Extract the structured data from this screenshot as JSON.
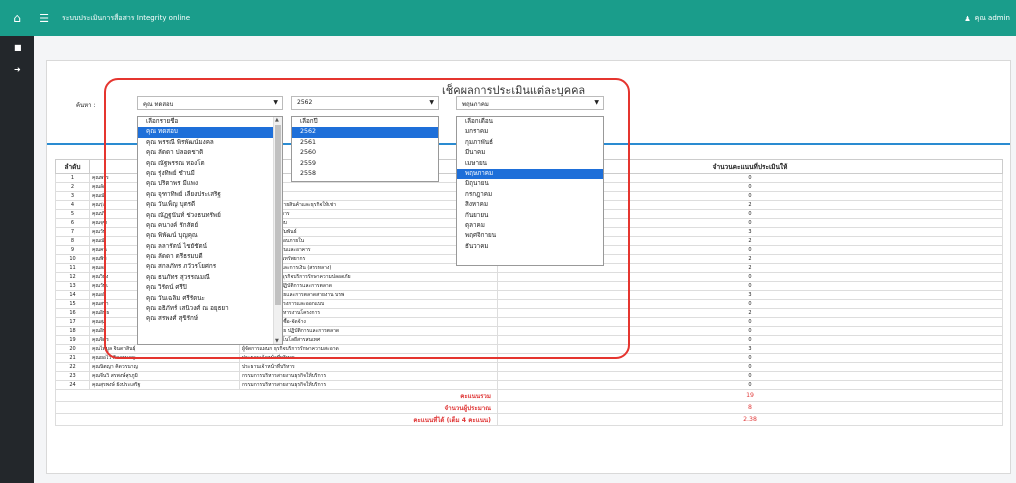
{
  "header": {
    "app_title": "ระบบประเมินการสื่อสาร Integrity online",
    "user": "คุณ admin"
  },
  "page": {
    "title": "เช็คผลการประเมินแต่ละบุคคล",
    "name_label": "ค้นหา :"
  },
  "filters": {
    "person": {
      "value": "คุณ ทดสอบ",
      "options": [
        "เลือกรายชื่อ",
        "คุณ ทดสอบ",
        "คุณ พรรณี พิรพัฒน์มงคล",
        "คุณ ลัดดา ปลอดชาติ",
        "คุณ ณัฐพรรณ ทองโต",
        "คุณ รุ่งทิพย์ ชำนมี",
        "คุณ ปริตาพร มีแพง",
        "คุณ จุฑาทิพย์ เลี่ยงประเสริฐ",
        "คุณ วันเพ็ญ บุตรดี",
        "คุณ ณัฏฐนันท์ ช่วงธนทรัพย์",
        "คุณ คนางค์ รักสัตย์",
        "คุณ พิพัฒน์ บุญคุณ",
        "คุณ ลลารัตน์ ไชยัชัตน์",
        "คุณ ลัดดา ตรีธรมบดี",
        "คุณ สกลภัทร ภวัวรโยศกร",
        "คุณ ธนภัทร สุวรรณมณี",
        "คุณ วิรัตน์ ศรีปิ",
        "คุณ วันเฉลิม ศรีรัตนะ",
        "คุณ อธิภัทร์ เสนิวงศ์ ณ อยุธยา",
        "คุณ สรพงศ์ สุขิรักษ์"
      ],
      "selected_index": 1
    },
    "year": {
      "value": "2562",
      "options": [
        "เลือกปี",
        "2562",
        "2561",
        "2560",
        "2559",
        "2558"
      ],
      "selected_index": 1
    },
    "month": {
      "value": "พฤษภาคม",
      "options": [
        "เลือกเดือน",
        "มกราคม",
        "กุมภาพันธ์",
        "มีนาคม",
        "เมษายน",
        "พฤษภาคม",
        "มิถุนายน",
        "กรกฎาคม",
        "สิงหาคม",
        "กันยายน",
        "ตุลาคม",
        "พฤศจิกายน",
        "ธันวาคม"
      ],
      "selected_index": 5
    }
  },
  "table": {
    "headers": {
      "order": "ลำดับ",
      "score": "จำนวนคะแนนที่ประเมินให้"
    },
    "rows": [
      {
        "no": "1",
        "name": "คุณพรร",
        "pos": "",
        "score": "0"
      },
      {
        "no": "2",
        "name": "คุณลัด",
        "pos": "",
        "score": "0"
      },
      {
        "no": "3",
        "name": "คุณณั",
        "pos": "",
        "score": "0"
      },
      {
        "no": "4",
        "name": "คุณรุ่ง",
        "pos": "ผู้จัดการฝ่ายธุรกิจขายสินค้าและธุรกิจให้เช่า",
        "score": "2"
      },
      {
        "no": "5",
        "name": "คุณปริ",
        "pos": "ผู้จัดการ ฝ่ายโครงการ",
        "score": "0"
      },
      {
        "no": "6",
        "name": "คุณจุฑ",
        "pos": "ผู้จัดการฝ่ายออกแบบ",
        "score": "0"
      },
      {
        "no": "7",
        "name": "คุณวัน",
        "pos": "ผู้จัดการฝ่ายลูกค้าสัมพันธ์",
        "score": "3"
      },
      {
        "no": "8",
        "name": "คุณณั",
        "pos": "ผู้จัดการฝ่ายตรวจสอบภายใน",
        "score": "2"
      },
      {
        "no": "9",
        "name": "คุณคน",
        "pos": "ผู้จัดการฝ่ายทรัพย์สินและอาคาร",
        "score": "0"
      },
      {
        "no": "10",
        "name": "คุณพิพ",
        "pos": "ผู้จัดการ ฝ่ายบริหารทรัพยากร",
        "score": "2"
      },
      {
        "no": "11",
        "name": "คุณลล",
        "pos": "ผู้จัดการ ฝ่ายบัญชีและการเงิน (สรรหลาง)",
        "score": "2"
      },
      {
        "no": "12",
        "name": "คุณวิธัง",
        "pos": "ผู้จัดการทั่วไป ฝ่ายธุรกิจบริการรักษาความปลอดภัย",
        "score": "0"
      },
      {
        "no": "13",
        "name": "คุณวันเ",
        "pos": "ผู้จัดการ ฝ่ายขาย ปฏิบัติการและการตลาด",
        "score": "0"
      },
      {
        "no": "14",
        "name": "คุณอธิ",
        "pos": "ผู้อำนวยการฝ่ายขายและการตลาดสายงาน บรพ",
        "score": "3"
      },
      {
        "no": "15",
        "name": "คุณสรา",
        "pos": "ผู้อำนวยการฝ่ายโครงการและออกแบบ",
        "score": "0"
      },
      {
        "no": "16",
        "name": "คุณอิทธ",
        "pos": "ผู้อำนวยการฝ่ายบริหารงานโครงการ",
        "score": "2"
      },
      {
        "no": "17",
        "name": "คุณสุภ",
        "pos": "ผู้อำนวยการฝ่ายจัดซื้อ-จัดจ้าง",
        "score": "0"
      },
      {
        "no": "18",
        "name": "คุณอิท",
        "pos": "ผู้อำนวยการฝ่ายขาย ปฏิบัติการและการตลาด",
        "score": "0"
      },
      {
        "no": "19",
        "name": "คุณจิตร",
        "pos": "ผู้จัดการแผนก เทคโนโลยีสารสนเทศ",
        "score": "0"
      },
      {
        "no": "20",
        "name": "คุณไพบูล จินดาสินธุ์",
        "pos": "ผู้จัดการแผนก ธุรกิจบริการรักษาความสะอาด",
        "score": "3"
      },
      {
        "no": "21",
        "name": "คุณยอไว้ คิดวรนาญ",
        "pos": "ประธานเจ้าหน้าที่บริหาร",
        "score": "0"
      },
      {
        "no": "22",
        "name": "คุณนิตญา คิดวรนาญ",
        "pos": "ประธานเจ้าหน้าที่บริหาร",
        "score": "0"
      },
      {
        "no": "23",
        "name": "คุณจีนวิ สรพงษ์สุรภูมิ",
        "pos": "กรรมการบริหารสายงานธุรกิจให้บริการ",
        "score": "0"
      },
      {
        "no": "24",
        "name": "คุณสุรพงษ์ ยังประเสริฐ",
        "pos": "กรรมการบริหารสายงานธุรกิจให้บริการ",
        "score": "0"
      }
    ],
    "summary": [
      {
        "label": "คะแนนรวม",
        "value": "19"
      },
      {
        "label": "จำนวนผู้ประมาณ",
        "value": "8"
      },
      {
        "label": "คะแนนที่ได้ (เต็ม 4 คะแนน)",
        "value": "2.38"
      }
    ]
  }
}
